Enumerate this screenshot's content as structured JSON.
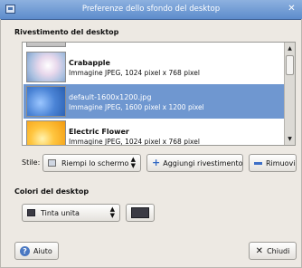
{
  "window": {
    "title": "Preferenze dello sfondo del desktop"
  },
  "wallpaper_section": {
    "label": "Rivestimento del desktop"
  },
  "wallpapers": [
    {
      "name": "Crabapple",
      "desc": "Immagine JPEG, 1024 pixel x 768 pixel",
      "selected": false
    },
    {
      "name": "default-1600x1200.jpg",
      "desc": "Immagine JPEG, 1600 pixel x 1200 pixel",
      "selected": true
    },
    {
      "name": "Electric Flower",
      "desc": "Immagine JPEG, 1024 pixel x 768 pixel",
      "selected": false
    }
  ],
  "style_row": {
    "label": "Stile:",
    "style_value": "Riempi lo schermo",
    "add_label": "Aggiungi rivestimento",
    "remove_label": "Rimuovi"
  },
  "colors_section": {
    "label": "Colori del desktop",
    "fill_value": "Tinta unita",
    "swatch_color": "#3b3b44"
  },
  "footer": {
    "help_label": "Aiuto",
    "close_label": "Chiudi"
  }
}
